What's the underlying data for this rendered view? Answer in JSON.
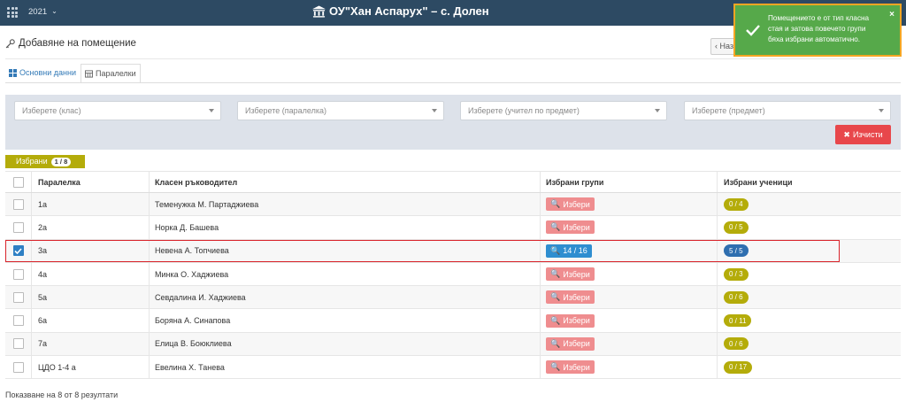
{
  "topbar": {
    "year": "2021",
    "school": "ОУ\"Хан Аспарух\" – с. Долен"
  },
  "page": {
    "title": "Добавяне на помещение",
    "back_label": "Наз"
  },
  "toast": {
    "message": "Помещението е от тип класна стая и затова повечето групи бяха избрани автоматично.",
    "close": "×"
  },
  "tabs": [
    {
      "label": "Основни данни"
    },
    {
      "label": "Паралелки"
    }
  ],
  "filters": {
    "class": "Изберете (клас)",
    "section": "Изберете (паралелка)",
    "teacher": "Изберете (учител по предмет)",
    "subject": "Изберете (предмет)",
    "clear_label": "Изчисти"
  },
  "selected": {
    "label": "Избрани",
    "count": "1 / 8"
  },
  "table": {
    "headers": {
      "section": "Паралелка",
      "teacher": "Класен ръководител",
      "groups": "Избрани групи",
      "students": "Избрани ученици"
    },
    "rows": [
      {
        "section": "1а",
        "teacher": "Теменужка М. Партаджиева",
        "groups": "Избери",
        "students": "0 / 4"
      },
      {
        "section": "2а",
        "teacher": "Норка Д. Башева",
        "groups": "Избери",
        "students": "0 / 5"
      },
      {
        "section": "3а",
        "teacher": "Невена А. Топчиева",
        "groups": "14 / 16",
        "students": "5 / 5"
      },
      {
        "section": "4а",
        "teacher": "Минка О. Хаджиева",
        "groups": "Избери",
        "students": "0 / 3"
      },
      {
        "section": "5а",
        "teacher": "Севдалина И. Хаджиева",
        "groups": "Избери",
        "students": "0 / 6"
      },
      {
        "section": "6а",
        "teacher": "Боряна А. Синапова",
        "groups": "Избери",
        "students": "0 / 11"
      },
      {
        "section": "7а",
        "teacher": "Елица В. Боюклиева",
        "groups": "Избери",
        "students": "0 / 6"
      },
      {
        "section": "ЦДО 1-4 а",
        "teacher": "Евелина Х. Танева",
        "groups": "Избери",
        "students": "0 / 17"
      }
    ]
  },
  "footer": {
    "results": "Показване на 8 от 8 резултати"
  },
  "colors": {
    "topbar": "#2d4a63",
    "toast": "#56a94a",
    "danger": "#e8474b",
    "olive_badge": "#b4ac0a",
    "pick_button": "#ef8d8f",
    "active_blue": "#2f8ed0"
  }
}
